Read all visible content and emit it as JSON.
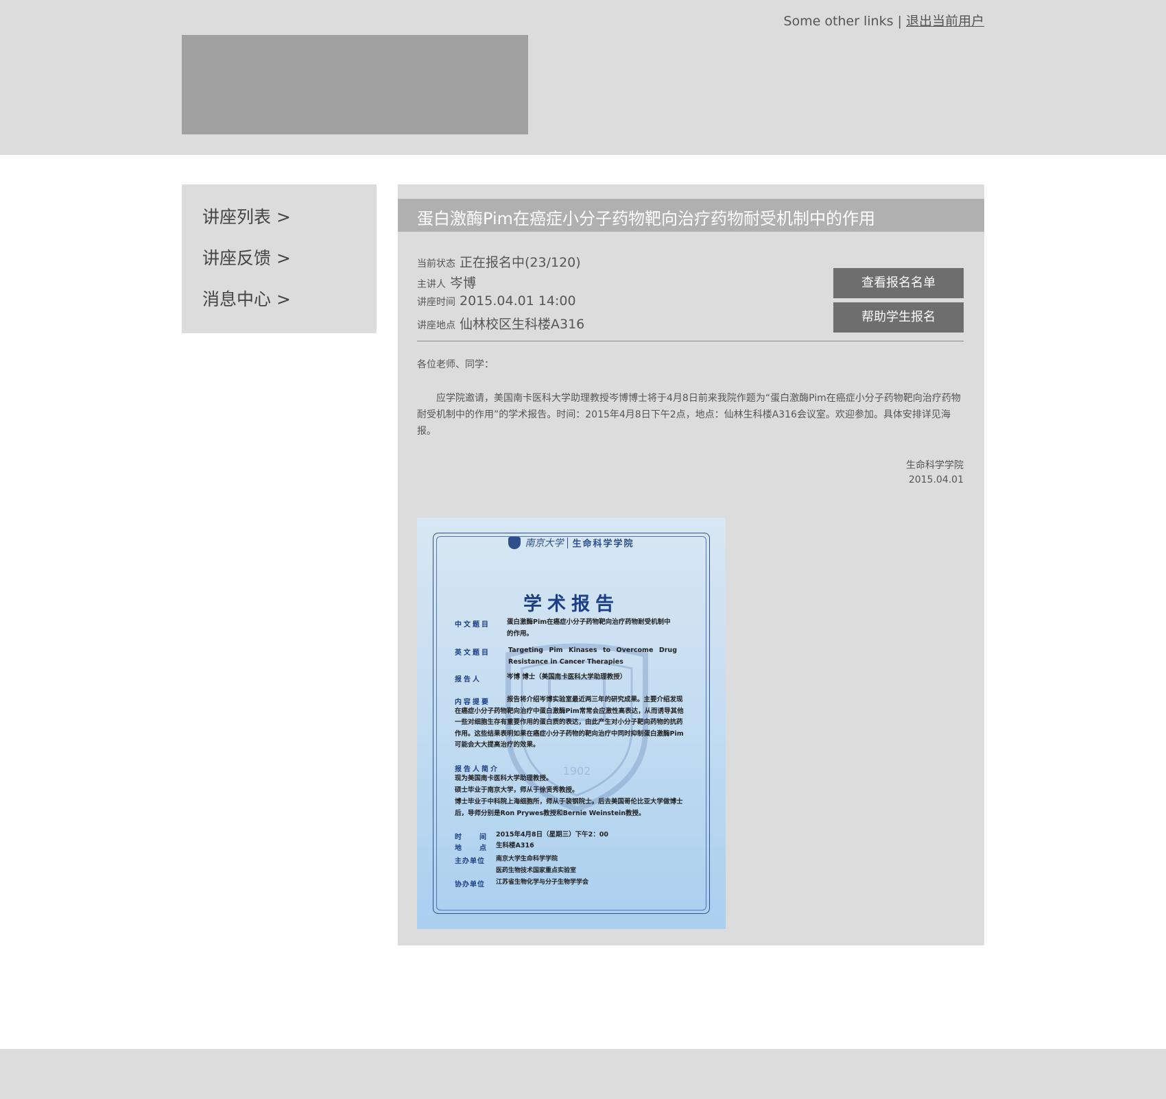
{
  "header": {
    "other_links": "Some other links",
    "separator": "|",
    "logout": "退出当前用户"
  },
  "sidebar": {
    "items": [
      {
        "label": "讲座列表 >"
      },
      {
        "label": "讲座反馈 >"
      },
      {
        "label": "消息中心 >"
      }
    ]
  },
  "lecture": {
    "title": "蛋白激酶Pim在癌症小分子药物靶向治疗药物耐受机制中的作用",
    "status_label": "当前状态",
    "status_value": "正在报名中(23/120)",
    "speaker_label": "主讲人",
    "speaker_value": "岑博",
    "time_label": "讲座时间",
    "time_value": "2015.04.01 14:00",
    "location_label": "讲座地点",
    "location_value": "仙林校区生科楼A316",
    "view_signups_button": "查看报名名单",
    "help_signup_button": "帮助学生报名",
    "greeting": "各位老师、同学：",
    "body": "应学院邀请，美国南卡医科大学助理教授岑博博士将于4月8日前来我院作题为“蛋白激酶Pim在癌症小分子药物靶向治疗药物耐受机制中的作用”的学术报告。时间：2015年4月8日下午2点，地点：仙林生科楼A316会议室。欢迎参加。具体安排详见海报。",
    "signature_org": "生命科学学院",
    "signature_date": "2015.04.01"
  },
  "poster": {
    "university": "南京大学",
    "school": "生命科学学院",
    "heading": "学术报告",
    "watermark_year": "1902",
    "cn_title_label": "中文题目",
    "cn_title": "蛋白激酶Pim在癌症小分子药物靶向治疗药物耐受机制中的作用。",
    "en_title_label": "英文题目",
    "en_title": "Targeting Pim Kinases to Overcome Drug Resistance in Cancer Therapies",
    "speaker_label": "报告人",
    "speaker": "岑博 博士（美国南卡医科大学助理教授）",
    "abstract_label": "内容提要",
    "abstract": "报告将介绍岑博实验室最近两三年的研究成果。主要介绍发现在癌症小分子药物靶向治疗中蛋白激酶Pim常常会应激性高表达，从而诱导其他一些对细胞生存有重要作用的蛋白质的表达，由此产生对小分子靶向药物的抗药作用。这些结果表明如果在癌症小分子药物的靶向治疗中同时抑制蛋白激酶Pim可能会大大提高治疗的效果。",
    "bio_label": "报告人简介",
    "bio_lines": [
      "现为美国南卡医科大学助理教授。",
      "硕士毕业于南京大学，师从于徐贤秀教授。",
      "博士毕业于中科院上海细胞所，师从于裴钢院士。后去美国哥伦比亚大学做博士后，导师分别是Ron Prywes教授和Bernie Weinstein教授。"
    ],
    "time_label": "时间",
    "time": "2015年4月8日（星期三）下午2：00",
    "location_label": "地点",
    "location": "生科楼A316",
    "host_label": "主办单位",
    "hosts": [
      "南京大学生命科学学院",
      "医药生物技术国家重点实验室"
    ],
    "co_host_label": "协办单位",
    "co_host": "江苏省生物化学与分子生物学学会"
  },
  "colors": {
    "header_bg": "#dcdcdc",
    "logo_placeholder": "#a0a0a0",
    "title_bar": "#b0b0b0",
    "button_bg": "#6e6e6e",
    "poster_blue": "#1c3f86"
  }
}
